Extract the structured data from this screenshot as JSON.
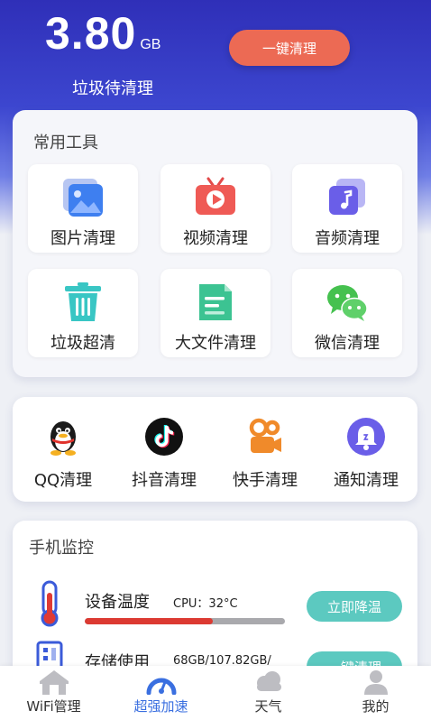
{
  "header": {
    "junk_value": "3.80",
    "junk_unit": "GB",
    "junk_label": "垃圾待清理",
    "clean_button": "一键清理"
  },
  "tools": {
    "title": "常用工具",
    "items": [
      {
        "label": "图片清理",
        "icon": "image-icon"
      },
      {
        "label": "视频清理",
        "icon": "video-tv-icon"
      },
      {
        "label": "音频清理",
        "icon": "music-note-icon"
      },
      {
        "label": "垃圾超清",
        "icon": "trash-bin-icon"
      },
      {
        "label": "大文件清理",
        "icon": "document-icon"
      },
      {
        "label": "微信清理",
        "icon": "wechat-icon"
      }
    ]
  },
  "apps": {
    "items": [
      {
        "label": "QQ清理",
        "icon": "qq-penguin-icon"
      },
      {
        "label": "抖音清理",
        "icon": "douyin-icon"
      },
      {
        "label": "快手清理",
        "icon": "kuaishou-camera-icon"
      },
      {
        "label": "通知清理",
        "icon": "bell-icon"
      }
    ]
  },
  "monitor": {
    "title": "手机监控",
    "rows": [
      {
        "name": "设备温度",
        "value": "CPU：32°C",
        "action": "立即降温",
        "level": 0.64,
        "icon": "thermometer-icon"
      },
      {
        "name": "存储使用",
        "value": "68GB/107.82GB/",
        "action": "一键清理",
        "icon": "storage-icon"
      }
    ]
  },
  "tabbar": {
    "items": [
      {
        "label": "WiFi管理",
        "icon": "home-icon"
      },
      {
        "label": "超强加速",
        "icon": "speedometer-icon"
      },
      {
        "label": "天气",
        "icon": "cloud-icon"
      },
      {
        "label": "我的",
        "icon": "user-icon"
      }
    ]
  },
  "colors": {
    "brand_blue": "#3c46cf",
    "clean_button": "#ec6a54",
    "action_teal": "#5cc9c0",
    "temp_bar": "#dc3a32",
    "accent_tab": "#3a6fe0"
  }
}
